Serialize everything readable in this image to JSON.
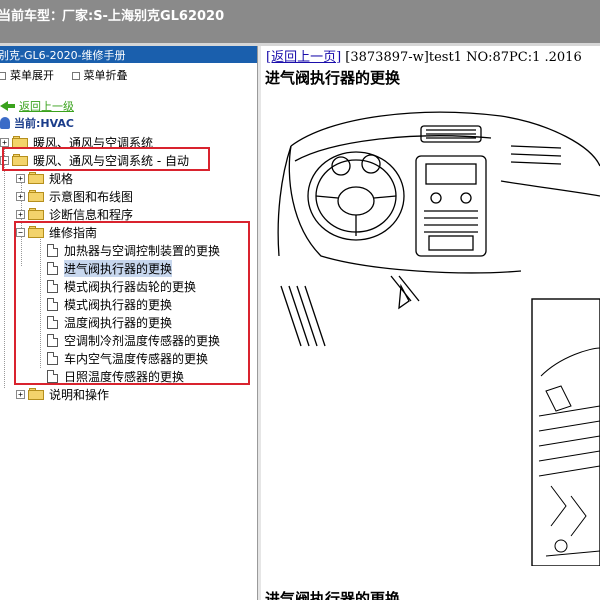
{
  "titlebar": {
    "label": "当前车型：",
    "vendor": "厂家:S-上海别克GL62020"
  },
  "sidebar": {
    "header": "别克-GL6-2020-维修手册",
    "expand_label": "菜单展开",
    "collapse_label": "菜单折叠",
    "back_link": "返回上一级",
    "current_label": "当前:HVAC"
  },
  "tree": [
    {
      "label": "暖风、通风与空调系统"
    },
    {
      "label": "暖风、通风与空调系统 - 自动"
    },
    {
      "label": "规格"
    },
    {
      "label": "示意图和布线图"
    },
    {
      "label": "诊断信息和程序"
    },
    {
      "label": "维修指南"
    },
    {
      "label": "加热器与空调控制装置的更换"
    },
    {
      "label": "进气阀执行器的更换"
    },
    {
      "label": "模式阀执行器齿轮的更换"
    },
    {
      "label": "模式阀执行器的更换"
    },
    {
      "label": "温度阀执行器的更换"
    },
    {
      "label": "空调制冷剂温度传感器的更换"
    },
    {
      "label": "车内空气温度传感器的更换"
    },
    {
      "label": "日照温度传感器的更换"
    },
    {
      "label": "说明和操作"
    }
  ],
  "content": {
    "back_link": "[返回上一页]",
    "doc_info": "[3873897-w]test1 NO:87PC:1 .2016",
    "title": "进气阀执行器的更换",
    "bottom_title": "进气阀执行器的更换"
  },
  "colors": {
    "sidebar_header": "#1a5fad",
    "highlight_box": "#d9232e",
    "titlebar": "#8a8a8a",
    "selected_row": "#c7d7ee"
  }
}
